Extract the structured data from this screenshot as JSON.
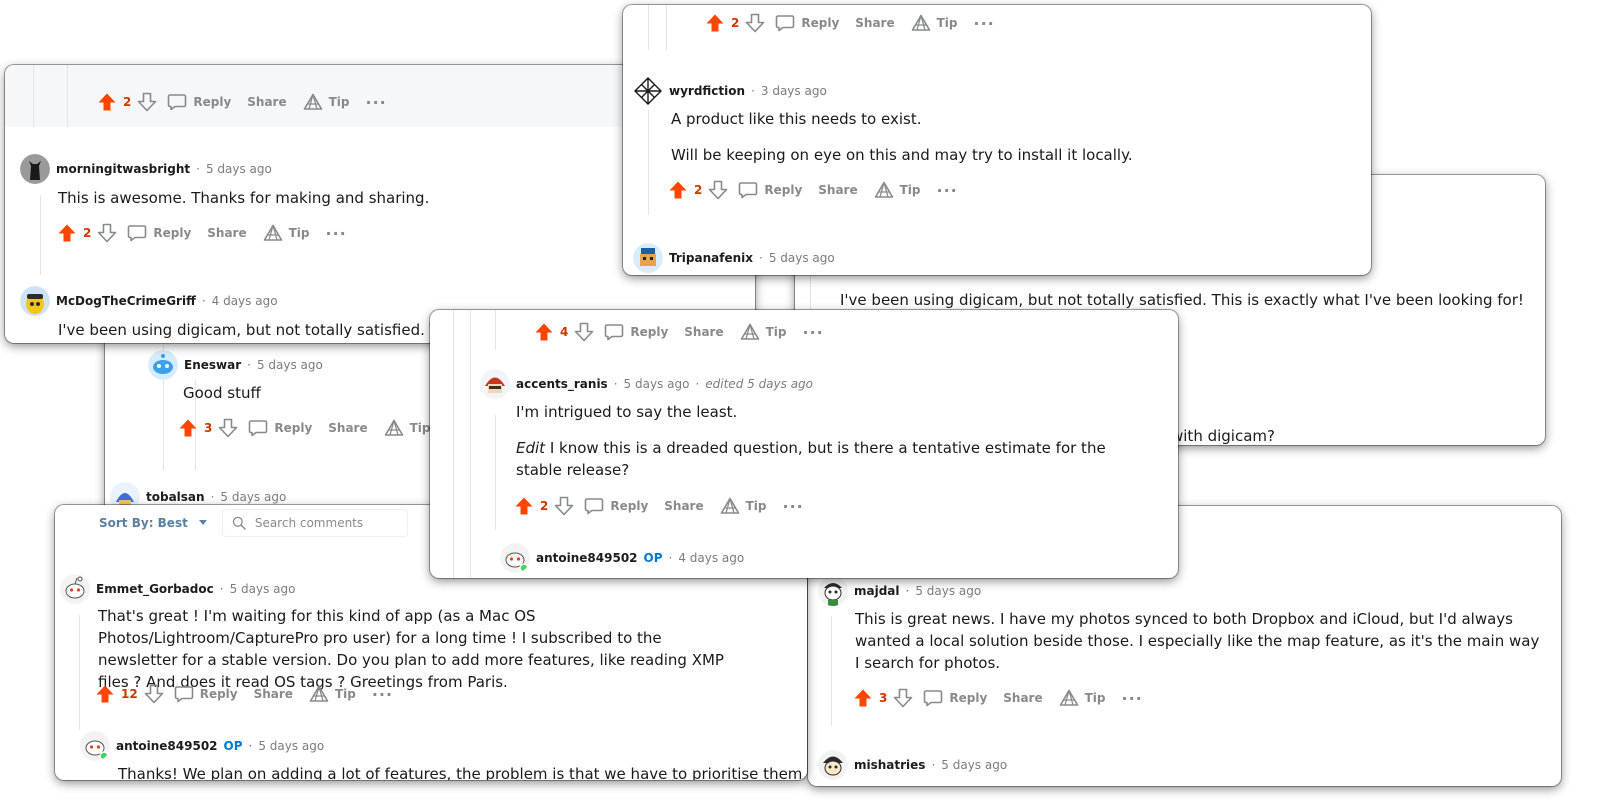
{
  "ui": {
    "reply": "Reply",
    "share": "Share",
    "tip": "Tip",
    "more": "···",
    "op": "OP",
    "dot": "·",
    "sort_label": "Sort By: Best",
    "search_placeholder": "Search comments"
  },
  "colors": {
    "upvote_active": "#ff4500",
    "vote_count": "#cc3700",
    "op_badge": "#0079d3",
    "action_text": "#878a8c",
    "online_dot": "#46d160"
  },
  "cards": {
    "c1": {
      "top_votes": "2",
      "comments": [
        {
          "username": "morningitwasbright",
          "time": "5 days ago",
          "text": "This is awesome. Thanks for making and sharing.",
          "votes": "2",
          "avatar_icon": "cat-silhouette-avatar"
        },
        {
          "username": "McDogTheCrimeGriff",
          "time": "4 days ago",
          "text": "I've been using digicam, but not totally satisfied. This is e",
          "avatar_icon": "yellow-bird-avatar"
        }
      ]
    },
    "c2": {
      "comments": [
        {
          "username": "Eneswar",
          "time": "5 days ago",
          "text": "Good stuff",
          "votes": "3",
          "avatar_icon": "snoo-avatar"
        },
        {
          "username": "tobalsan",
          "time": "5 days ago",
          "avatar_icon": "blue-helmet-avatar"
        }
      ]
    },
    "c3": {
      "top_votes": "2",
      "comments": [
        {
          "username": "wyrdfiction",
          "time": "3 days ago",
          "paragraphs": [
            "A product like this needs to exist.",
            "Will be keeping on eye on this and may try to install it locally."
          ],
          "votes": "2",
          "avatar_icon": "geometric-avatar"
        },
        {
          "username": "Tripanafenix",
          "time": "5 days ago",
          "avatar_icon": "pixel-character-avatar"
        }
      ]
    },
    "c4": {
      "text1": "I've been using digicam, but not totally satisfied. This is exactly what I've been looking for!",
      "text2": "with digicam?"
    },
    "c5": {
      "top_votes": "4",
      "comments": [
        {
          "username": "accents_ranis",
          "time": "5 days ago",
          "edited": "edited 5 days ago",
          "para1": "I'm intrigued to say the least.",
          "para2_em": "Edit",
          "para2_rest": " I know this is a dreaded question, but is there a tentative estimate for the stable release?",
          "votes": "2",
          "avatar_icon": "red-helmet-avatar"
        },
        {
          "username": "antoine849502",
          "time": "4 days ago",
          "op": true,
          "avatar_icon": "snoo-avatar"
        }
      ]
    },
    "c6": {
      "comments": [
        {
          "username": "Emmet_Gorbadoc",
          "time": "5 days ago",
          "text": "That's great ! I'm waiting for this kind of app (as a Mac OS Photos/Lightroom/CapturePro pro user) for a long time ! I subscribed to the newsletter for a stable version. Do you plan to add more features, like reading XMP files ? And does it read OS tags ? Greetings from Paris.",
          "votes": "12",
          "avatar_icon": "snoo-avatar"
        },
        {
          "username": "antoine849502",
          "time": "5 days ago",
          "op": true,
          "text": "Thanks! We plan on adding a lot of features, the problem is that we have to prioritise them.",
          "avatar_icon": "snoo-avatar"
        }
      ]
    },
    "c7": {
      "comments": [
        {
          "username": "majdal",
          "time": "5 days ago",
          "text": "This is great news. I have my photos synced to both Dropbox and iCloud, but I'd always wanted a local solution beside those. I especially like the map feature, as it's the main way I search for photos.",
          "votes": "3",
          "avatar_icon": "cartoon-face-avatar"
        },
        {
          "username": "mishatries",
          "time": "5 days ago",
          "avatar_icon": "cartoon-face-avatar"
        }
      ]
    }
  }
}
